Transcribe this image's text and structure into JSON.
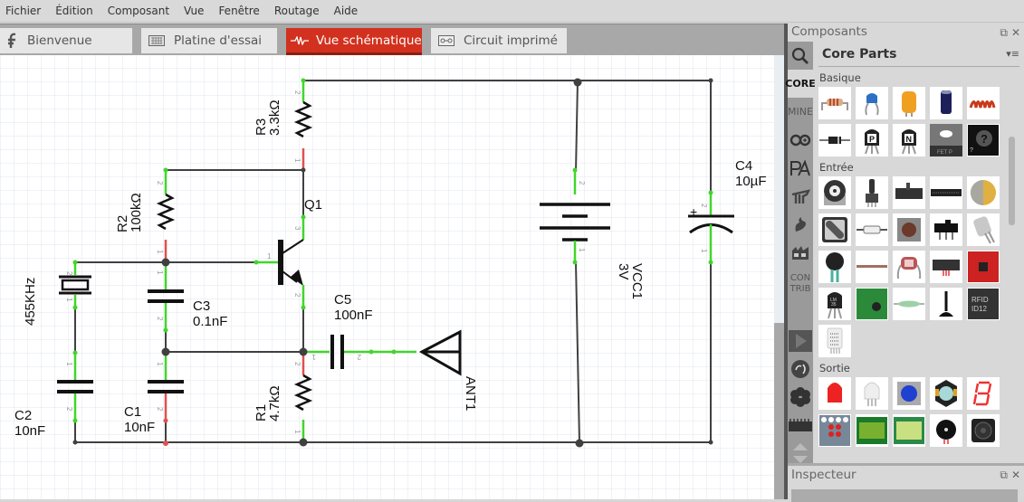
{
  "menu": [
    "Fichier",
    "Édition",
    "Composant",
    "Vue",
    "Fenêtre",
    "Routage",
    "Aide"
  ],
  "tabs": [
    {
      "label": "Bienvenue",
      "icon": "fritzing-logo-icon",
      "active": false
    },
    {
      "label": "Platine d'essai",
      "icon": "breadboard-icon",
      "active": false
    },
    {
      "label": "Vue schématique",
      "icon": "resistor-zigzag-icon",
      "active": true
    },
    {
      "label": "Circuit imprimé",
      "icon": "pcb-icon",
      "active": false
    }
  ],
  "schematic": {
    "components": [
      {
        "ref": "R3",
        "value": "3.3kΩ",
        "type": "resistor"
      },
      {
        "ref": "R2",
        "value": "100kΩ",
        "type": "resistor"
      },
      {
        "ref": "R1",
        "value": "4.7kΩ",
        "type": "resistor"
      },
      {
        "ref": "Q1",
        "value": "",
        "type": "npn-transistor"
      },
      {
        "ref": "C1",
        "value": "10nF",
        "type": "capacitor"
      },
      {
        "ref": "C2",
        "value": "10nF",
        "type": "capacitor"
      },
      {
        "ref": "C3",
        "value": "0.1nF",
        "type": "capacitor"
      },
      {
        "ref": "C4",
        "value": "10µF",
        "type": "electrolytic-capacitor"
      },
      {
        "ref": "C5",
        "value": "100nF",
        "type": "capacitor"
      },
      {
        "ref": "VCC1",
        "value": "3V",
        "type": "battery"
      },
      {
        "ref": "ANT1",
        "value": "",
        "type": "antenna"
      },
      {
        "ref": "",
        "value": "455KHz",
        "type": "crystal"
      }
    ],
    "pin_labels": {
      "one": "1",
      "two": "2",
      "three": "3"
    },
    "plus": "+"
  },
  "panel": {
    "title": "Composants",
    "bin_title": "Core Parts",
    "bin_tabs": [
      "CORE",
      "MINE",
      "CON\nTRIB"
    ],
    "sections": [
      {
        "label": "Basique",
        "parts": [
          "resistor",
          "ceramic-capacitor",
          "tantalum-capacitor",
          "electrolytic-capacitor",
          "inductor",
          "diode",
          "pnp-transistor",
          "npn-transistor",
          "fet-transistor",
          "mystery-part"
        ]
      },
      {
        "label": "Entrée",
        "parts": [
          "potentiometer",
          "slide-potentiometer",
          "rotary-potentiometer",
          "dip-switch",
          "piezo",
          "rotary-encoder",
          "reed-switch",
          "pushbutton",
          "slide-switch",
          "tilt-switch",
          "fsr",
          "flex-sensor",
          "photocell",
          "ir-sensor",
          "accelerometer",
          "temperature-sensor",
          "bluetooth-module",
          "reed-relay",
          "joystick",
          "rfid-reader",
          "humidity-sensor"
        ]
      },
      {
        "label": "Sortie",
        "parts": [
          "red-led",
          "white-led",
          "rgb-led",
          "power-led",
          "seven-segment-display",
          "led-matrix",
          "lcd-display",
          "lcd-graphic",
          "buzzer",
          "speaker"
        ]
      }
    ],
    "fet_text": "FET P",
    "lm35_text": "LM\n35",
    "rfid_text": "RFID ID12"
  },
  "inspector": {
    "title": "Inspecteur"
  },
  "colors": {
    "accent": "#d2311f",
    "pin_ok": "#41d62b",
    "pin_bad": "#e05050",
    "wire": "#404040"
  }
}
